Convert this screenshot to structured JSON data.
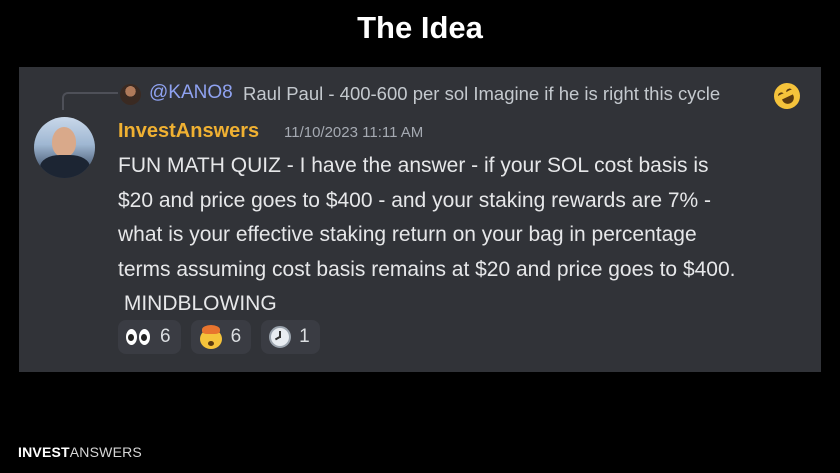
{
  "slide": {
    "title": "The Idea"
  },
  "reply": {
    "username": "@KANO8",
    "text": "Raul Paul - 400-600 per sol Imagine if he is right this cycle",
    "emoji": "rolling-on-floor-laughing-icon"
  },
  "message": {
    "author": "InvestAnswers",
    "timestamp": "11/10/2023 11:11 AM",
    "lines": [
      "FUN MATH QUIZ - I have the answer - if your SOL cost basis is",
      "$20 and price goes to $400 - and your staking rewards are 7% -",
      "what is your effective staking return on your bag in percentage",
      "terms assuming cost basis remains at $20 and price goes to $400.",
      " MINDBLOWING"
    ],
    "author_color": "#f0b132"
  },
  "reactions": [
    {
      "icon": "eyes-icon",
      "count": "6"
    },
    {
      "icon": "mind-blown-icon",
      "count": "6"
    },
    {
      "icon": "clock-icon",
      "count": "1"
    }
  ],
  "footer": {
    "brand_strong": "INVEST",
    "brand_light": "ANSWERS"
  }
}
